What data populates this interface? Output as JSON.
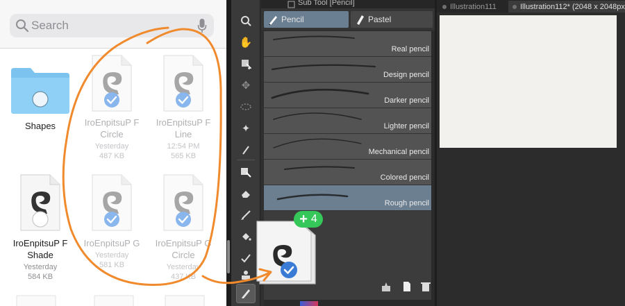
{
  "files": {
    "search": {
      "placeholder": "Search"
    },
    "items": [
      {
        "name": "Shapes",
        "date": "",
        "size": ""
      },
      {
        "name": "IroEnpitsuP F Circle",
        "date": "Yesterday",
        "size": "487 KB"
      },
      {
        "name": "IroEnpitsuP F Line",
        "date": "12:54 PM",
        "size": "565 KB"
      },
      {
        "name": "IroEnpitsuP F Shade",
        "date": "Yesterday",
        "size": "584 KB"
      },
      {
        "name": "IroEnpitsuP G",
        "date": "Yesterday",
        "size": "581 KB"
      },
      {
        "name": "IroEnpitsuP G Circle",
        "date": "Yesterday",
        "size": "437 KB"
      }
    ]
  },
  "clip_studio": {
    "subtool_title": "Sub Tool [Pencil]",
    "subtool_tabs": [
      "Pencil",
      "Pastel"
    ],
    "brushes": [
      {
        "name": "Real pencil"
      },
      {
        "name": "Design pencil"
      },
      {
        "name": "Darker pencil"
      },
      {
        "name": "Lighter pencil"
      },
      {
        "name": "Mechanical pencil"
      },
      {
        "name": "Colored pencil"
      },
      {
        "name": "Rough pencil"
      }
    ],
    "selected_brush": "Rough pencil",
    "canvas_tabs": [
      "Illustration111",
      "Illustration112* (2048 x 2048px"
    ],
    "active_canvas_tab": "Illustration112* (2048 x 2048px"
  },
  "drag": {
    "badge_count": "4"
  },
  "colors": {
    "annotation": "#f08a2c",
    "badge": "#35c759",
    "check": "#3a7bd5",
    "folder": "#7cc3f0"
  },
  "icons": [
    "search-icon",
    "mic-icon",
    "folder-icon",
    "clip-studio-logo-icon",
    "checkmark-icon",
    "pencil-icon",
    "pastel-icon",
    "trash-icon"
  ]
}
